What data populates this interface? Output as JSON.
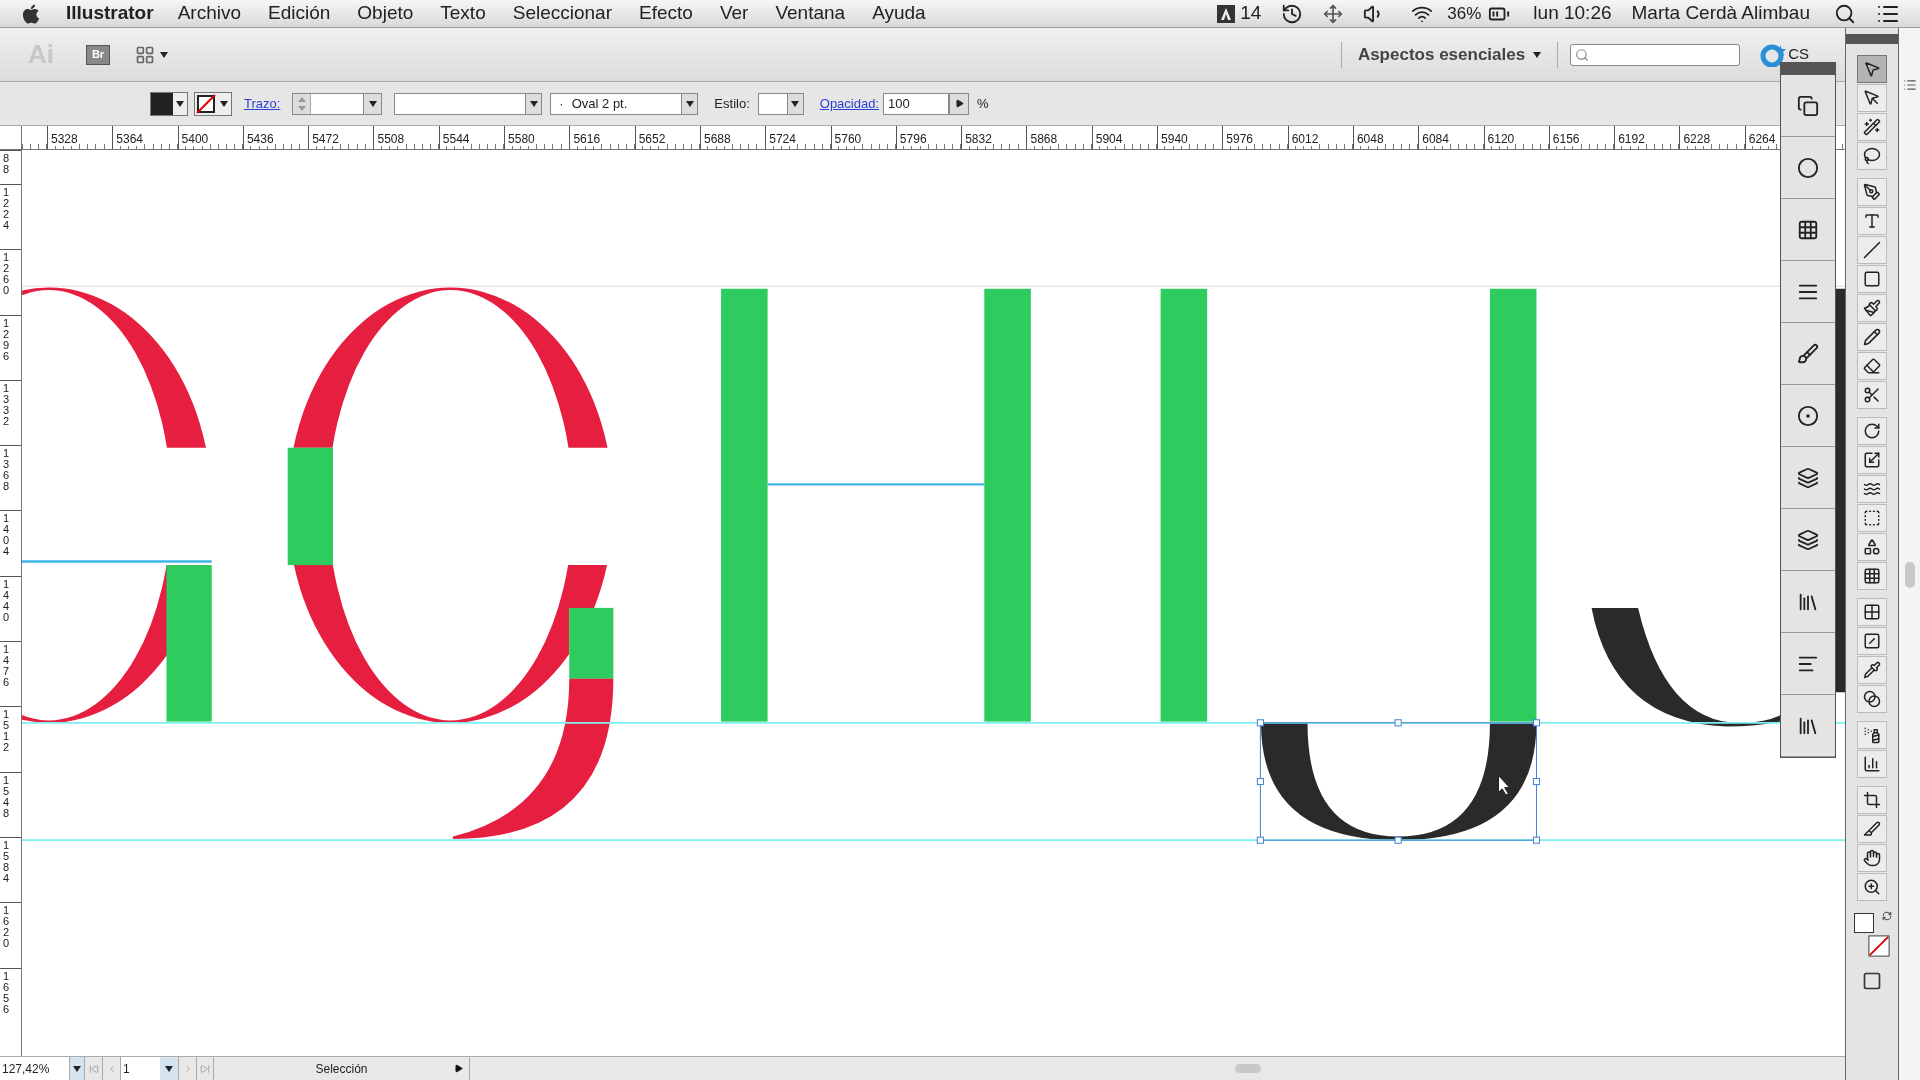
{
  "menu_bar": {
    "app_name": "Illustrator",
    "menus": [
      "Archivo",
      "Edición",
      "Objeto",
      "Texto",
      "Seleccionar",
      "Efecto",
      "Ver",
      "Ventana",
      "Ayuda"
    ],
    "adobe_count": "14",
    "battery": "36%",
    "clock": "lun 10:26",
    "user": "Marta Cerdà Alimbau"
  },
  "app_bar": {
    "logo": "Ai",
    "bridge_button": "Br",
    "workspace": "Aspectos esenciales",
    "cs_live": "CS"
  },
  "control_bar": {
    "stroke_label": "Trazo:",
    "brush_dot": "·",
    "brush": "Oval 2 pt.",
    "style_label": "Estilo:",
    "opacity_label": "Opacidad:",
    "opacity_value": "100",
    "percent": "%"
  },
  "rulers": {
    "horizontal": [
      "5328",
      "5364",
      "5400",
      "5436",
      "5472",
      "5508",
      "5544",
      "5580",
      "5616",
      "5652",
      "5688",
      "5724",
      "5760",
      "5796",
      "5832",
      "5868",
      "5904",
      "5940",
      "5976",
      "6012",
      "6048",
      "6084",
      "6120",
      "6156",
      "6192",
      "6228",
      "6264"
    ],
    "vertical": [
      "88",
      "1224",
      "1260",
      "1296",
      "1332",
      "1368",
      "1404",
      "1440",
      "1476",
      "1512",
      "1548",
      "1584",
      "1620",
      "1656"
    ]
  },
  "toolbox": {
    "tools": [
      {
        "kind": "selection",
        "selected": true
      },
      {
        "kind": "direct",
        "selected": false
      },
      {
        "kind": "wand",
        "selected": false
      },
      {
        "kind": "lasso",
        "selected": false
      },
      {
        "kind": "pen",
        "selected": false
      },
      {
        "kind": "type",
        "selected": false
      },
      {
        "kind": "line",
        "selected": false
      },
      {
        "kind": "rect",
        "selected": false
      },
      {
        "kind": "brush",
        "selected": false
      },
      {
        "kind": "pencil",
        "selected": false
      },
      {
        "kind": "blob",
        "selected": false
      },
      {
        "kind": "scissors",
        "selected": false
      },
      {
        "kind": "rotate",
        "selected": false
      },
      {
        "kind": "scale",
        "selected": false
      },
      {
        "kind": "warp",
        "selected": false
      },
      {
        "kind": "transform",
        "selected": false
      },
      {
        "kind": "shapebuilder",
        "selected": false
      },
      {
        "kind": "perspective",
        "selected": false
      },
      {
        "kind": "mesh",
        "selected": false
      },
      {
        "kind": "gradient",
        "selected": false
      },
      {
        "kind": "eyedropper",
        "selected": false
      },
      {
        "kind": "blend",
        "selected": false
      },
      {
        "kind": "spray",
        "selected": false
      },
      {
        "kind": "graph",
        "selected": false
      },
      {
        "kind": "artboard",
        "selected": false
      },
      {
        "kind": "slice",
        "selected": false
      },
      {
        "kind": "hand",
        "selected": false
      },
      {
        "kind": "zoom",
        "selected": false
      }
    ]
  },
  "status_bar": {
    "zoom": "127,42%",
    "artboard": "1",
    "tool": "Selección"
  }
}
